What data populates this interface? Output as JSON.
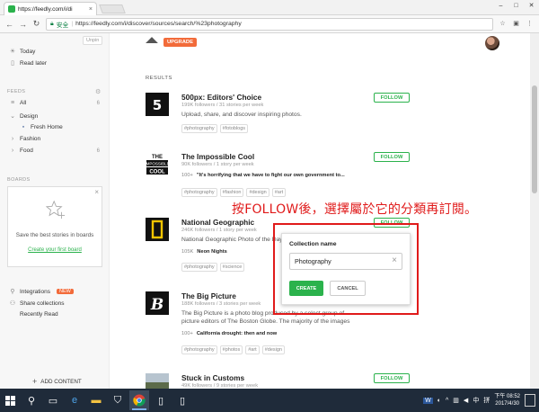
{
  "browser": {
    "tab_title": "https://feedly.com/i/di",
    "tab_close": "×",
    "window_controls": [
      "–",
      "□",
      "✕"
    ],
    "secure_label": "安全",
    "url": "https://feedly.com/i/discover/sources/search/%23photography",
    "back": "←",
    "forward": "→",
    "reload": "↻",
    "home": "⌂"
  },
  "sidebar": {
    "unpin": "Unpin",
    "today": "Today",
    "read_later": "Read later",
    "feeds_header": "FEEDS",
    "all": "All",
    "all_count": "6",
    "design": "Design",
    "fresh_home": "Fresh Home",
    "fashion": "Fashion",
    "food": "Food",
    "food_count": "6",
    "boards_header": "BOARDS",
    "boards_desc": "Save the best stories in boards",
    "boards_link": "Create your first board",
    "integrations": "Integrations",
    "new_badge": "NEW",
    "share_collections": "Share collections",
    "recently_read": "Recently Read",
    "add_content": "ADD CONTENT"
  },
  "main": {
    "upgrade": "UPGRADE",
    "results_label": "RESULTS",
    "follow_label": "FOLLOW",
    "results": [
      {
        "name": "500px: Editors' Choice",
        "meta": "199K followers / 31 stories per week",
        "desc": "Upload, share, and discover inspiring photos.",
        "hit_eng": "",
        "hit_text": "",
        "tags": [
          "#photography",
          "#fotoblogs"
        ]
      },
      {
        "name": "The Impossible Cool",
        "meta": "90K followers / 1 story per week",
        "desc": "",
        "hit_eng": "100+",
        "hit_text": "\"It's horrifying that we have to fight our own government to...",
        "tags": [
          "#photography",
          "#fashion",
          "#design",
          "#art"
        ]
      },
      {
        "name": "National Geographic",
        "meta": "246K followers / 1 story per week",
        "desc": "National Geographic Photo of the Day",
        "hit_eng": "105K",
        "hit_text": "Neon Nights",
        "tags": [
          "#photography",
          "#science"
        ]
      },
      {
        "name": "The Big Picture",
        "meta": "188K followers / 3 stories per week",
        "desc": "The Big Picture is a photo blog produced by a select group of picture editors of The Boston Globe. The majority of the images",
        "hit_eng": "100+",
        "hit_text": "California drought: then and now",
        "tags": [
          "#photography",
          "#photos",
          "#art",
          "#design"
        ]
      },
      {
        "name": "Stuck in Customs",
        "meta": "49K followers / 9 stories per week",
        "desc": "",
        "hit_eng": "",
        "hit_text": "",
        "tags": []
      }
    ]
  },
  "popup": {
    "label": "Collection name",
    "value": "Photography",
    "clear": "×",
    "create": "CREATE",
    "cancel": "CANCEL"
  },
  "annotation": {
    "text": "按FOLLOW後，選擇屬於它的分類再訂閱。",
    "color": "#e01a1a"
  },
  "taskbar": {
    "time": "下午 08:52",
    "date": "2017/4/30",
    "ime": "中",
    "ime2": "拼"
  },
  "colors": {
    "accent_green": "#2bb24c",
    "upgrade_orange": "#f26b3a",
    "taskbar": "#1f2b3a"
  }
}
